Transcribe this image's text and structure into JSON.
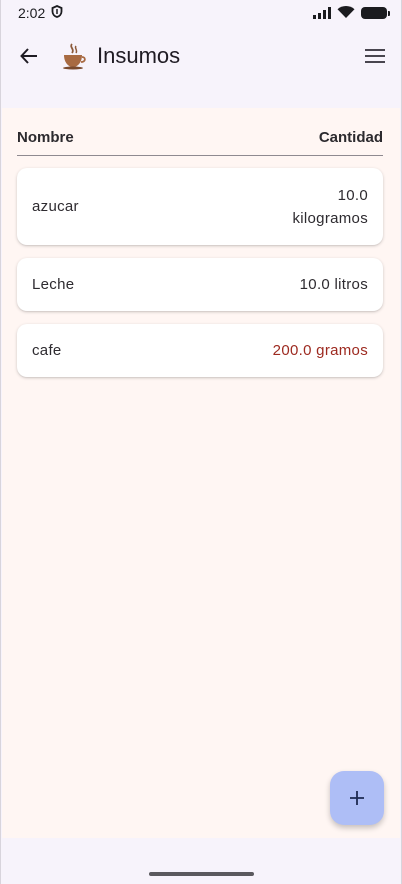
{
  "status_bar": {
    "time": "2:02",
    "shield_icon": "shield-icon",
    "signal_icon": "signal-icon",
    "wifi_icon": "wifi-icon",
    "battery_icon": "battery-icon"
  },
  "app_bar": {
    "title": "Insumos",
    "back_icon": "arrow-back-icon",
    "logo_icon": "coffee-cup-icon",
    "menu_icon": "hamburger-menu-icon"
  },
  "table": {
    "headers": {
      "name": "Nombre",
      "quantity": "Cantidad"
    },
    "rows": [
      {
        "name": "azucar",
        "quantity": "10.0 kilogramos",
        "low_stock": false
      },
      {
        "name": "Leche",
        "quantity": "10.0 litros",
        "low_stock": false
      },
      {
        "name": "cafe",
        "quantity": "200.0 gramos",
        "low_stock": true
      }
    ]
  },
  "fab": {
    "icon": "plus-icon"
  },
  "colors": {
    "background": "#f7f3fb",
    "content_background": "#fff6f3",
    "fab": "#aebef6",
    "low_stock_text": "#9d2a20"
  }
}
